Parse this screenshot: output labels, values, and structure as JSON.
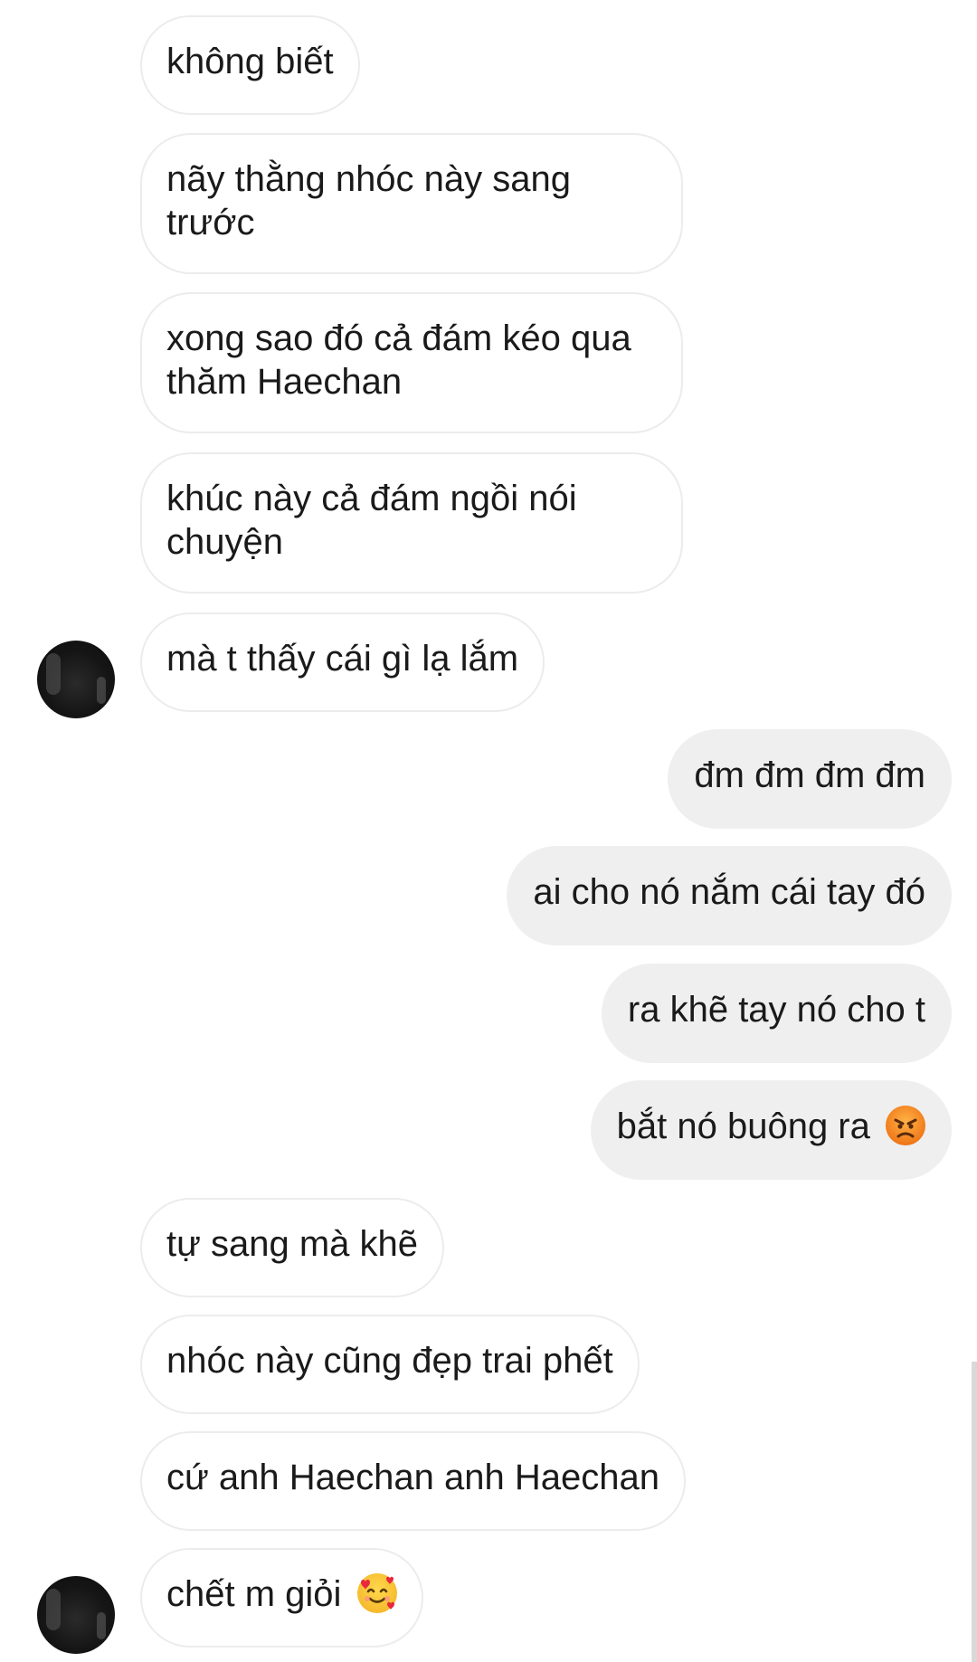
{
  "messages": [
    {
      "side": "in",
      "text": "không biết"
    },
    {
      "side": "in",
      "text": "nãy thằng nhóc này sang trước"
    },
    {
      "side": "in",
      "text": "xong sao đó cả đám kéo qua thăm Haechan"
    },
    {
      "side": "in",
      "text": "khúc này cả đám ngồi nói chuyện"
    },
    {
      "side": "in",
      "text": "mà t thấy cái gì lạ lắm"
    },
    {
      "side": "out",
      "text": "đm đm đm đm"
    },
    {
      "side": "out",
      "text": "ai cho nó nắm cái tay đó"
    },
    {
      "side": "out",
      "text": "ra khẽ tay nó cho t"
    },
    {
      "side": "out",
      "text": "bắt nó buông ra",
      "emoji": "angry-face-emoji"
    },
    {
      "side": "in",
      "text": "tự sang mà khẽ"
    },
    {
      "side": "in",
      "text": "nhóc này cũng đẹp trai phết"
    },
    {
      "side": "in",
      "text": "cứ anh Haechan anh Haechan"
    },
    {
      "side": "in",
      "text": "chết m giỏi",
      "emoji": "smiling-face-with-hearts-emoji"
    }
  ],
  "colors": {
    "incoming_bubble": "#ffffff",
    "incoming_border": "#ececec",
    "outgoing_bubble": "#efefef",
    "text": "#1a1a1a"
  }
}
